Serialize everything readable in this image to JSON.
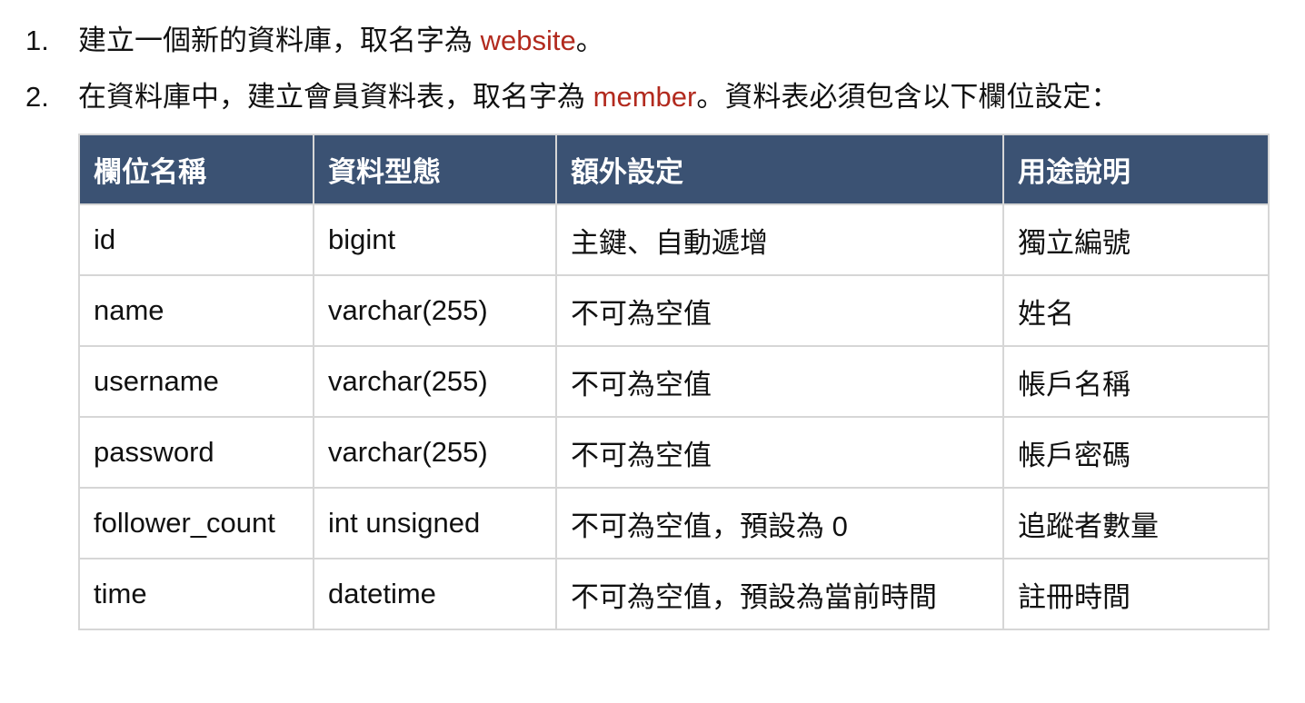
{
  "instructions": [
    {
      "number": "1.",
      "before": "建立一個新的資料庫，取名字為 ",
      "keyword": "website",
      "after": "。"
    },
    {
      "number": "2.",
      "before": "在資料庫中，建立會員資料表，取名字為 ",
      "keyword": "member",
      "after": "。資料表必須包含以下欄位設定："
    }
  ],
  "table": {
    "headers": [
      "欄位名稱",
      "資料型態",
      "額外設定",
      "用途說明"
    ],
    "rows": [
      [
        "id",
        "bigint",
        "主鍵、自動遞增",
        "獨立編號"
      ],
      [
        "name",
        "varchar(255)",
        "不可為空值",
        "姓名"
      ],
      [
        "username",
        "varchar(255)",
        "不可為空值",
        "帳戶名稱"
      ],
      [
        "password",
        "varchar(255)",
        "不可為空值",
        "帳戶密碼"
      ],
      [
        "follower_count",
        "int unsigned",
        "不可為空值，預設為 0",
        "追蹤者數量"
      ],
      [
        "time",
        "datetime",
        "不可為空值，預設為當前時間",
        "註冊時間"
      ]
    ]
  },
  "colors": {
    "header_bg": "#3b5273",
    "keyword": "#b22a1e",
    "grid": "#d6d6d6"
  }
}
